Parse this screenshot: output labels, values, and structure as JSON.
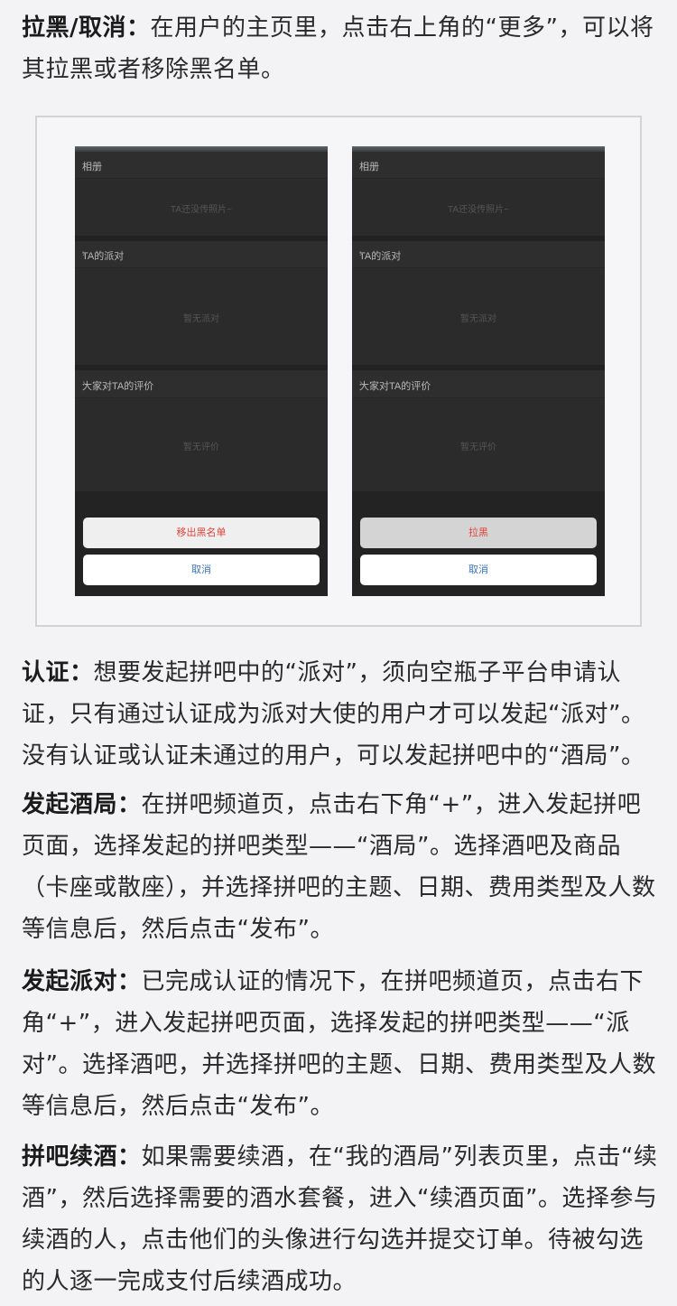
{
  "sections": {
    "block": {
      "lead": "拉黑/取消：",
      "text": "在用户的主页里，点击右上角的“更多”，可以将其拉黑或者移除黑名单。"
    },
    "verify": {
      "lead": "认证：",
      "text": "想要发起拼吧中的“派对”，须向空瓶子平台申请认证，只有通过认证成为派对大使的用户才可以发起“派对”。没有认证或认证未通过的用户，可以发起拼吧中的“酒局”。"
    },
    "bar": {
      "lead": "发起酒局：",
      "text": "在拼吧频道页，点击右下角“+”，进入发起拼吧页面，选择发起的拼吧类型——“酒局”。选择酒吧及商品（卡座或散座），并选择拼吧的主题、日期、费用类型及人数等信息后，然后点击“发布”。"
    },
    "party": {
      "lead": "发起派对：",
      "text": "已完成认证的情况下，在拼吧频道页，点击右下角“+”，进入发起拼吧页面，选择发起的拼吧类型——“派对”。选择酒吧，并选择拼吧的主题、日期、费用类型及人数等信息后，然后点击“发布”。"
    },
    "refill": {
      "lead": "拼吧续酒：",
      "text": "如果需要续酒，在“我的酒局”列表页里，点击“续酒”，然后选择需要的酒水套餐，进入“续酒页面”。选择参与续酒的人，点击他们的头像进行勾选并提交订单。待被勾选的人逐一完成支付后续酒成功。"
    }
  },
  "phones": {
    "left": {
      "album_title": "相册",
      "album_empty": "TA还没传照片~",
      "party_title": "TA的派对",
      "party_empty": "暂无派对",
      "review_title": "大家对TA的评价",
      "review_empty": "暂无评价",
      "action_label": "移出黑名单",
      "cancel_label": "取消"
    },
    "right": {
      "album_title": "相册",
      "album_empty": "TA还没传照片~",
      "party_title": "TA的派对",
      "party_empty": "暂无派对",
      "review_title": "大家对TA的评价",
      "review_empty": "暂无评价",
      "action_label": "拉黑",
      "cancel_label": "取消"
    }
  },
  "icons": {
    "chevron": "chevron-right-icon"
  },
  "colors": {
    "page_bg": "#f3f3f5",
    "phone_bg": "#2d2d2d",
    "action_red": "#e0443a",
    "cancel_blue": "#3a72c8"
  }
}
